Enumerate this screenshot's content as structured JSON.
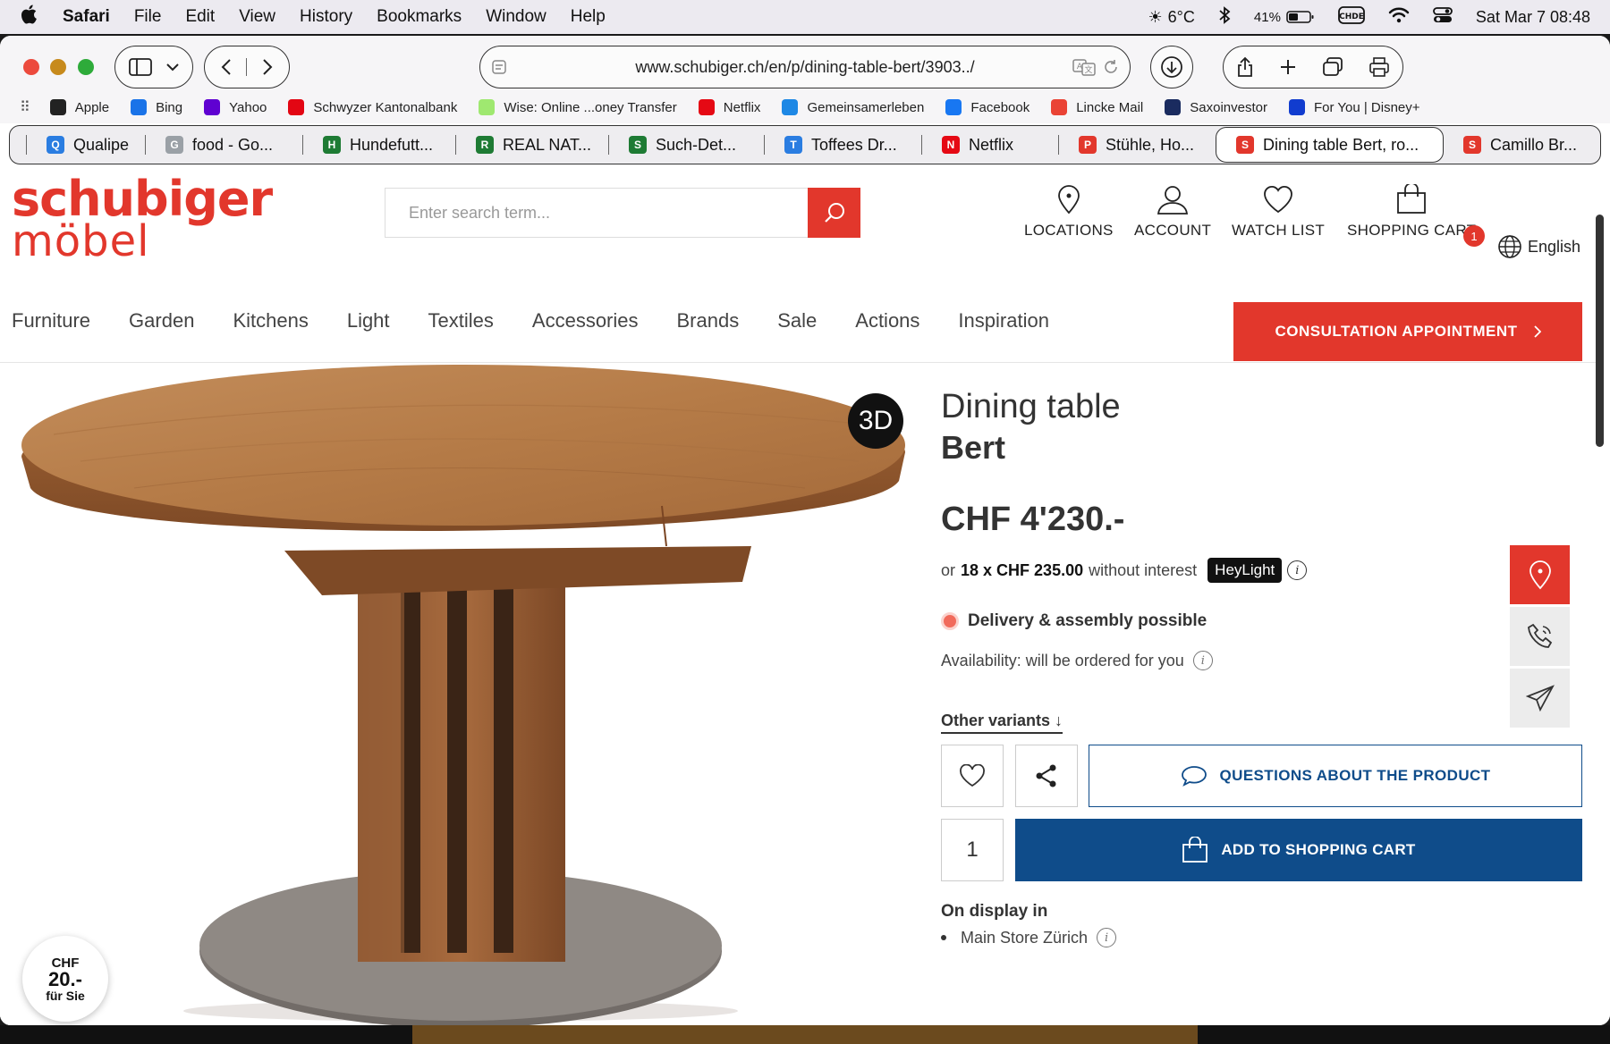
{
  "menubar": {
    "app": "Safari",
    "items": [
      "File",
      "Edit",
      "View",
      "History",
      "Bookmarks",
      "Window",
      "Help"
    ],
    "weather": "6°C",
    "battery": "41%",
    "datetime": "Sat Mar 7  08:48"
  },
  "browser": {
    "url": "www.schubiger.ch/en/p/dining-table-bert/3903../",
    "favorites": [
      {
        "label": "Apple",
        "icon": "apple-icon",
        "color": "#222"
      },
      {
        "label": "Bing",
        "icon": "search-icon",
        "color": "#1a73e8"
      },
      {
        "label": "Yahoo",
        "icon": "yahoo-icon",
        "color": "#5f01d1"
      },
      {
        "label": "Schwyzer Kantonalbank",
        "icon": "szkb-icon",
        "color": "#e30613"
      },
      {
        "label": "Wise: Online ...oney Transfer",
        "icon": "wise-icon",
        "color": "#9fe870"
      },
      {
        "label": "Netflix",
        "icon": "netflix-icon",
        "color": "#e50914"
      },
      {
        "label": "Gemeinsamerleben",
        "icon": "ge-icon",
        "color": "#1e88e5"
      },
      {
        "label": "Facebook",
        "icon": "facebook-icon",
        "color": "#1877f2"
      },
      {
        "label": "Lincke Mail",
        "icon": "gmail-icon",
        "color": "#ea4335"
      },
      {
        "label": "Saxoinvestor",
        "icon": "saxo-icon",
        "color": "#1a2b5f"
      },
      {
        "label": "For You | Disney+",
        "icon": "disney-icon",
        "color": "#113ccf"
      }
    ],
    "tabs": [
      {
        "label": "Qualipe",
        "color": "#2a7de1",
        "glyph": "Q"
      },
      {
        "label": "food - Go...",
        "color": "#9aa0a6",
        "glyph": "G"
      },
      {
        "label": "Hundefutt...",
        "color": "#1e7b34",
        "glyph": "H"
      },
      {
        "label": "REAL NAT...",
        "color": "#1e7b34",
        "glyph": "R"
      },
      {
        "label": "Such-Det...",
        "color": "#1e7b34",
        "glyph": "S"
      },
      {
        "label": "Toffees Dr...",
        "color": "#2a7de1",
        "glyph": "T"
      },
      {
        "label": "Netflix",
        "color": "#e50914",
        "glyph": "N"
      },
      {
        "label": "Stühle, Ho...",
        "color": "#e2372c",
        "glyph": "P"
      },
      {
        "label": "Dining table Bert, ro...",
        "color": "#e2372c",
        "glyph": "S",
        "active": true
      },
      {
        "label": "Camillo Br...",
        "color": "#e2372c",
        "glyph": "S"
      }
    ]
  },
  "site": {
    "logo_line1": "schubiger",
    "logo_line2": "möbel",
    "search_placeholder": "Enter search term...",
    "header_icons": {
      "locations": "LOCATIONS",
      "account": "ACCOUNT",
      "watchlist": "WATCH LIST",
      "cart": "SHOPPING CART",
      "cart_count": "1"
    },
    "language": "English",
    "nav": [
      "Furniture",
      "Garden",
      "Kitchens",
      "Light",
      "Textiles",
      "Accessories",
      "Brands",
      "Sale",
      "Actions",
      "Inspiration"
    ],
    "consultation": "CONSULTATION APPOINTMENT",
    "accent": "#e2372c",
    "primary": "#0f4c8a"
  },
  "product": {
    "title_line1": "Dining table",
    "title_line2": "Bert",
    "badge_3d": "3D",
    "price": "CHF 4'230.-",
    "finance_prefix": "or",
    "finance_amount": "18 x CHF 235.00",
    "finance_suffix": "without interest",
    "finance_provider": "HeyLight",
    "delivery": "Delivery & assembly possible",
    "availability": "Availability: will be ordered for you",
    "other_variants": "Other variants ↓",
    "questions": "QUESTIONS ABOUT THE PRODUCT",
    "quantity": "1",
    "add_to_cart": "ADD TO SHOPPING CART",
    "on_display_heading": "On display in",
    "on_display_store": "Main Store Zürich",
    "promo_line1": "CHF",
    "promo_line2": "20.-",
    "promo_line3": "für Sie"
  }
}
